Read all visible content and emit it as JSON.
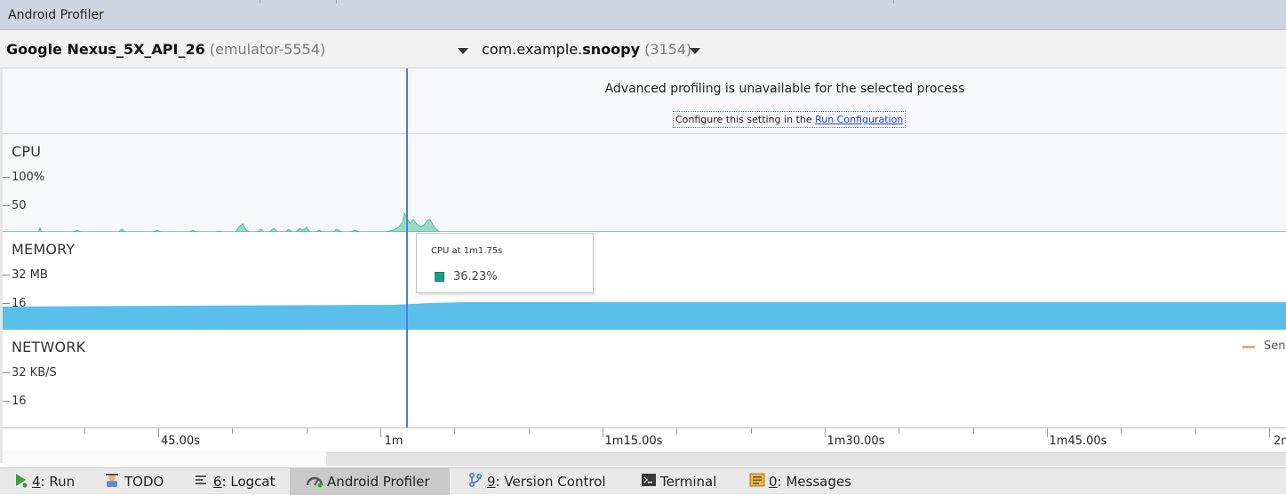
{
  "window": {
    "title": "Android Profiler"
  },
  "device": {
    "name": "Google Nexus_5X_API_26",
    "serial": "(emulator-5554)"
  },
  "process": {
    "package": "com.example.",
    "app": "snoopy",
    "pid": "(3154)"
  },
  "notice": {
    "message": "Advanced profiling is unavailable for the selected process",
    "config_prefix": "Configure this setting in the ",
    "config_link": "Run Configuration"
  },
  "cpu": {
    "label": "CPU",
    "y_max_label": "100%",
    "y_mid_label": "50",
    "color": "#4fc09a"
  },
  "memory": {
    "label": "MEMORY",
    "y_max_label": "32 MB",
    "y_mid_label": "16",
    "color": "#5bbfec"
  },
  "network": {
    "label": "NETWORK",
    "y_max_label": "32 KB/S",
    "y_mid_label": "16",
    "legend_label": "Sen",
    "legend_color": "#e9ae6a"
  },
  "tooltip": {
    "title": "CPU at 1m1.75s",
    "value": "36.23%",
    "swatch_color": "#1e9c83"
  },
  "timeline": {
    "labels": [
      "45.00s",
      "1m",
      "1m15.00s",
      "1m30.00s",
      "1m45.00s",
      "2m"
    ]
  },
  "toolwindows": [
    {
      "mnemonic": "4",
      "label": ": Run",
      "icon": "run-icon"
    },
    {
      "mnemonic": "",
      "label": "TODO",
      "icon": "todo-icon"
    },
    {
      "mnemonic": "6",
      "label": ": Logcat",
      "icon": "logcat-icon"
    },
    {
      "mnemonic": "",
      "label": "Android Profiler",
      "icon": "profiler-icon",
      "active": true
    },
    {
      "mnemonic": "9",
      "label": ": Version Control",
      "icon": "version-control-icon"
    },
    {
      "mnemonic": "",
      "label": "Terminal",
      "icon": "terminal-icon"
    },
    {
      "mnemonic": "0",
      "label": ": Messages",
      "icon": "messages-icon"
    }
  ]
}
